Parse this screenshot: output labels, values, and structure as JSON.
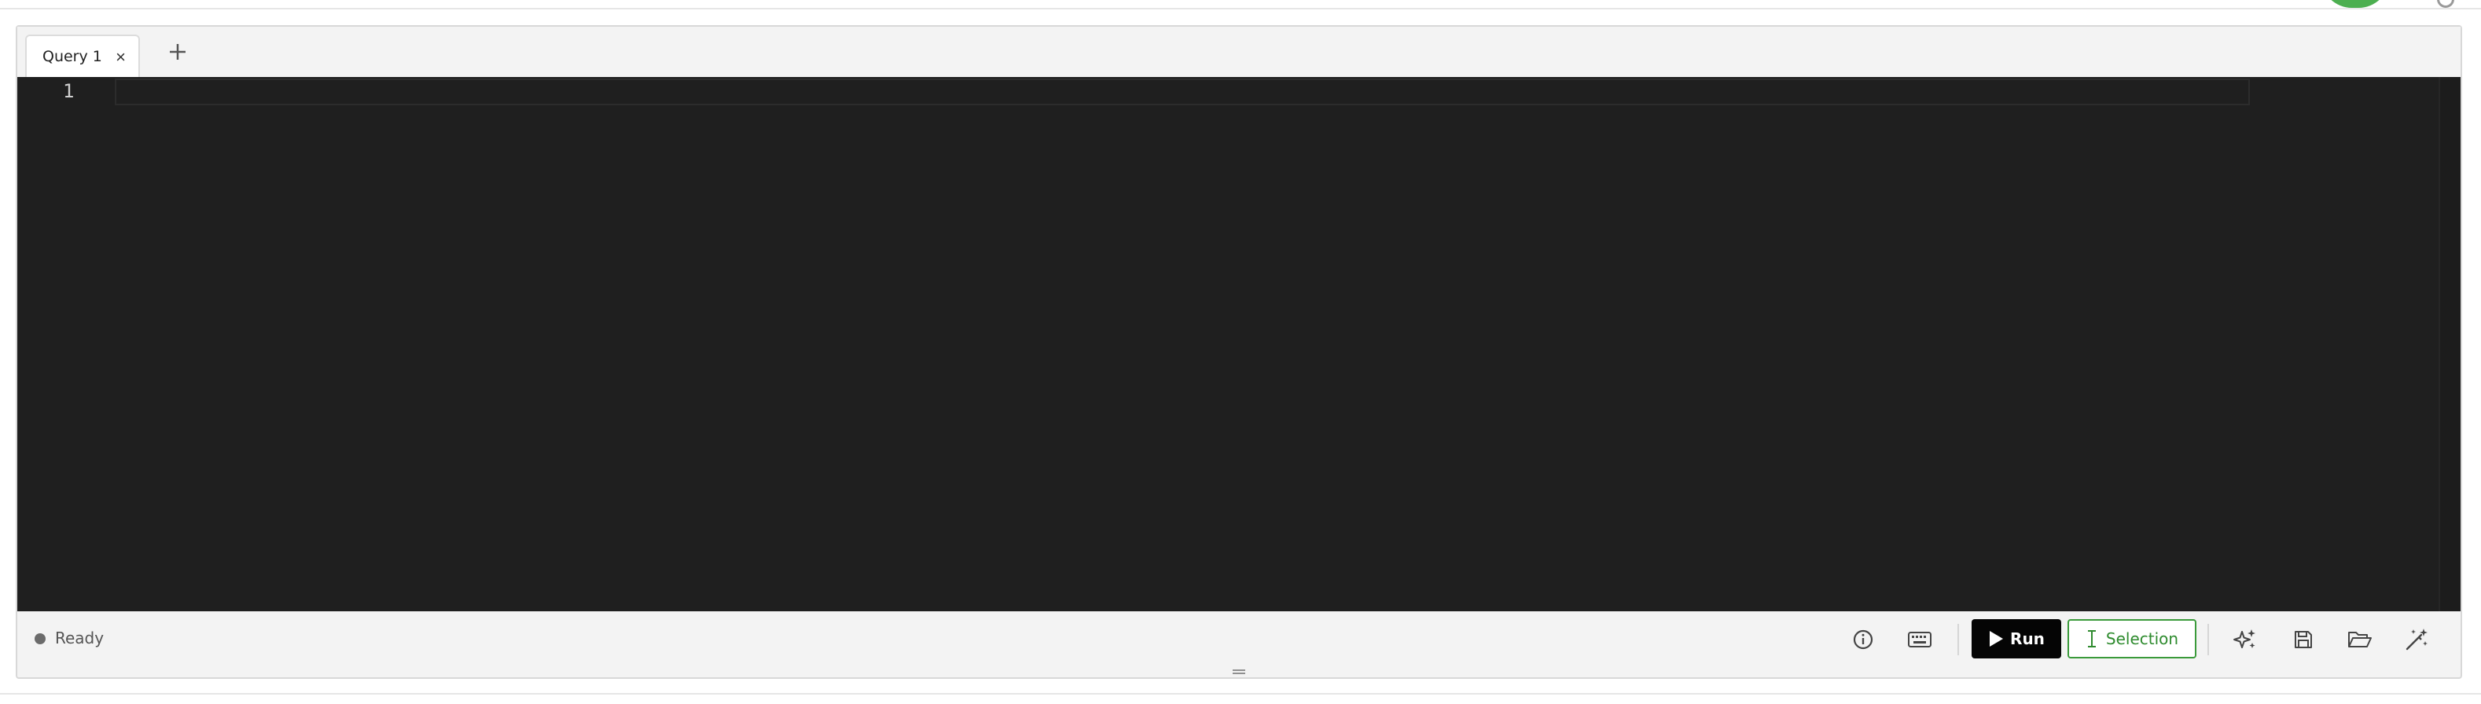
{
  "tabs": [
    {
      "label": "Query 1",
      "close": "×"
    }
  ],
  "add_tab": "+",
  "editor": {
    "line_numbers": [
      "1"
    ]
  },
  "status": {
    "text": "Ready"
  },
  "toolbar": {
    "run_label": "Run",
    "selection_label": "Selection"
  },
  "icons": {
    "info": "info-icon",
    "keyboard": "keyboard-icon",
    "play": "play-icon",
    "text_cursor": "text-cursor-icon",
    "sparkles": "sparkles-icon",
    "save": "save-icon",
    "folder": "folder-open-icon",
    "wand": "magic-wand-icon"
  },
  "colors": {
    "editor_bg": "#1f1f1f",
    "run_bg": "#050505",
    "selection_accent": "#2e8b2e",
    "avatar": "#4caf50"
  }
}
